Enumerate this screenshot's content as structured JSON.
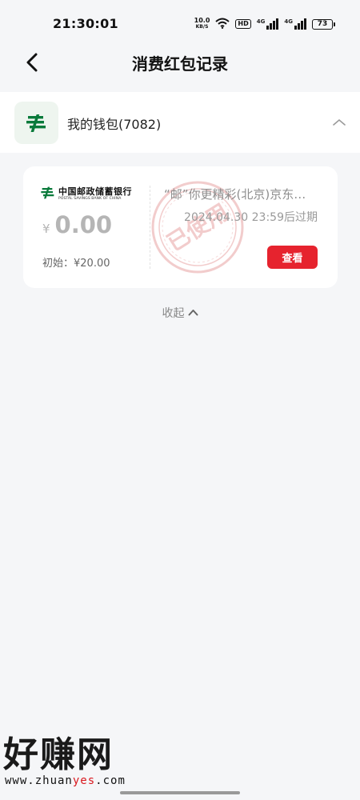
{
  "status_bar": {
    "time": "21:30:01",
    "net_speed": "10.0",
    "net_unit": "KB/S",
    "hd_label": "HD",
    "signal1_label": "4G",
    "signal2_label": "4G",
    "battery": "73",
    "icons": [
      "wifi-icon",
      "signal-icon",
      "battery-icon"
    ]
  },
  "header": {
    "title": "消费红包记录",
    "back_icon": "chevron-left-icon"
  },
  "wallet": {
    "name": "我的钱包(7082)",
    "logo_icon": "postal-logo-icon",
    "toggle_icon": "chevron-up-icon",
    "expanded": true
  },
  "coupon": {
    "bank_name_cn": "中国邮政储蓄银行",
    "bank_name_en": "POSTAL SAVINGS BANK OF CHINA",
    "currency": "¥",
    "amount": "0.00",
    "initial": "初始：¥20.00",
    "title": "“邮”你更精彩(北京)京东…",
    "expire": "2024.04.30 23:59后过期",
    "stamp_text": "已使用",
    "view_button": "查看"
  },
  "collapse": {
    "label": "收起",
    "icon": "chevron-up-icon"
  },
  "watermark": {
    "main": "好赚网",
    "url_prefix": "www.zhuan",
    "url_highlight": "yes",
    "url_suffix": ".com"
  },
  "colors": {
    "accent_red": "#e6232e",
    "postal_green": "#0a7a3b",
    "background": "#f5f6f8"
  }
}
